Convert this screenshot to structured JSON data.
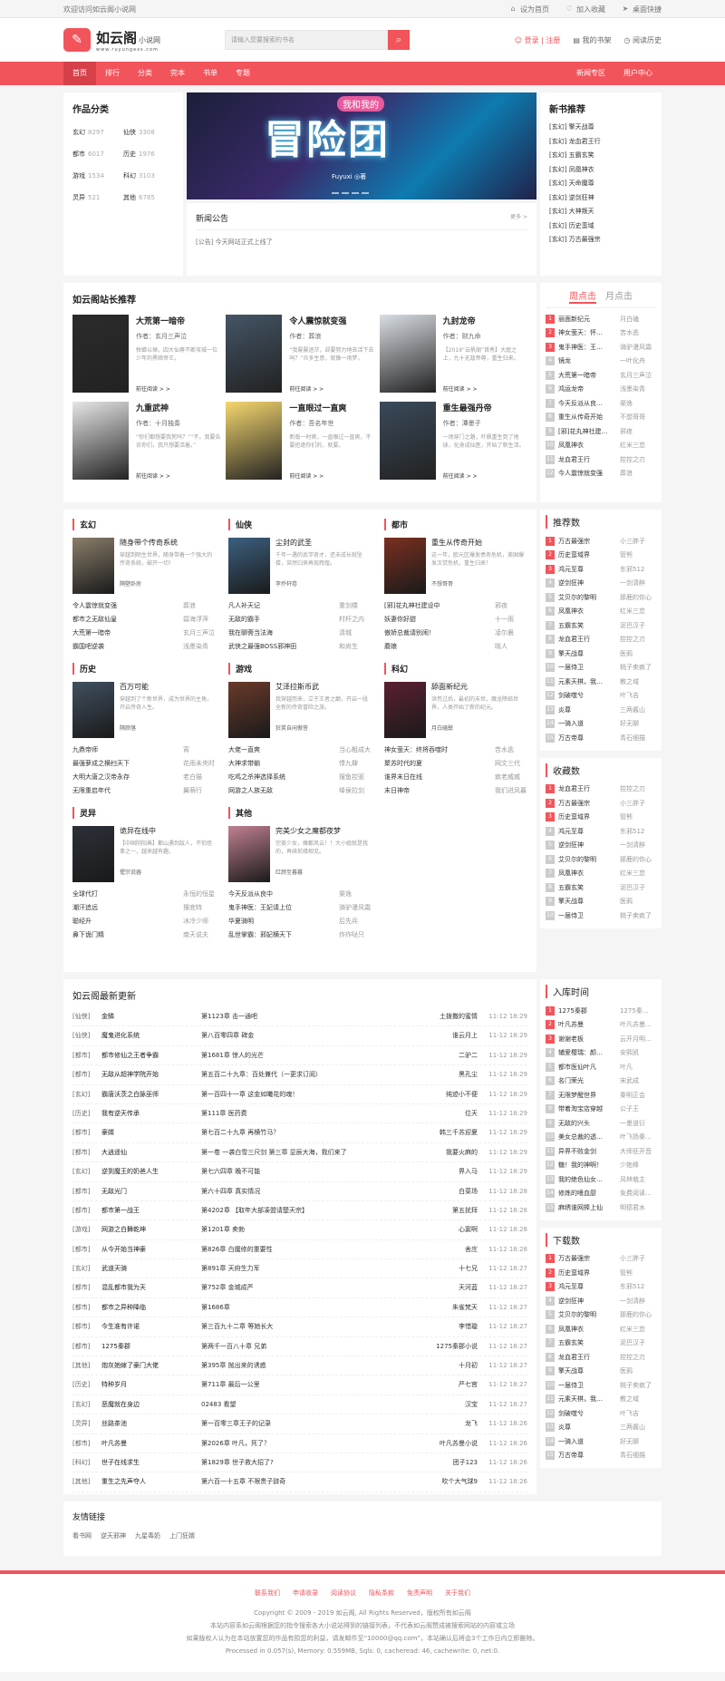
{
  "topbar": {
    "welcome": "欢迎访问如云阁小说网",
    "set_home": "设为首页",
    "favorite": "加入收藏",
    "shortcut": "桌面快捷"
  },
  "header": {
    "logo_name": "如云阁",
    "logo_sub": "小说网",
    "logo_url": "www.ruyungexs.com",
    "search_placeholder": "请输入您要搜索的书名",
    "login": "登录 | 注册",
    "my_shelf": "我的书架",
    "history": "阅读历史"
  },
  "nav": {
    "items": [
      "首页",
      "排行",
      "分类",
      "完本",
      "书单",
      "专题"
    ],
    "right": [
      "新闻专区",
      "用户中心"
    ]
  },
  "categories": {
    "title": "作品分类",
    "items": [
      {
        "name": "玄幻",
        "count": "8297"
      },
      {
        "name": "仙侠",
        "count": "3308"
      },
      {
        "name": "都市",
        "count": "6017"
      },
      {
        "name": "历史",
        "count": "1976"
      },
      {
        "name": "游戏",
        "count": "1534"
      },
      {
        "name": "科幻",
        "count": "3103"
      },
      {
        "name": "灵异",
        "count": "521"
      },
      {
        "name": "其他",
        "count": "6785"
      }
    ]
  },
  "banner": {
    "title": "冒险团",
    "subtitle": "我和我的",
    "author": "Fuyuxi ◎著"
  },
  "news": {
    "title": "新闻公告",
    "more": "更多 >",
    "item": "[公告] 今天网站正式上线了"
  },
  "new_books": {
    "title": "新书推荐",
    "items": [
      "[玄幻] 擎天战尊",
      "[玄幻] 龙血君王行",
      "[玄幻] 五霸玄笑",
      "[玄幻] 凤凰神衣",
      "[玄幻] 天命魔尊",
      "[玄幻] 逆剑狂神",
      "[玄幻] 大神叛天",
      "[玄幻] 历史蛮域",
      "[玄幻] 万古最强宗"
    ]
  },
  "recommend": {
    "title": "如云阁站长推荐",
    "read": "前往阅读 > >",
    "books": [
      {
        "title": "大荒第一暗帝",
        "author": "作者：玄月三声泣",
        "desc": "牧蝉以禅，四大仙尊不断攻城一位少年的黑暗帝王。",
        "color": "#2b2b2b"
      },
      {
        "title": "令人震惊就变强",
        "author": "作者：葬浪",
        "desc": "“我屡屡迷茫，却要努力地去活下去吗？”众多生意，就像一场梦。",
        "color": "#445566"
      },
      {
        "title": "九封龙帝",
        "author": "作者：财九命",
        "desc": "【2019“云帆阁”首秀】大庭之上，九十无敌帝尊，重生归来。",
        "color": "#d9dee4"
      },
      {
        "title": "九重武神",
        "author": "作者：十月独奏",
        "desc": "“你们都想要我死吗？”“不，我要告诉你们，我只想要活着。”",
        "color": "#e6e6e6"
      },
      {
        "title": "一直眼过一直爽",
        "author": "作者：吾名年世",
        "desc": "新版一时爽，一直眼过一直爽，不要拒绝你们的，就要。",
        "color": "#f5d76e"
      },
      {
        "title": "重生最强丹帝",
        "author": "作者：潭墨子",
        "desc": "一场穿门之路，叶枫重生到了地球，化身成仙医，开始了新生活。",
        "color": "#3a4a5a"
      }
    ]
  },
  "rank_click": {
    "tabs": [
      "周点击",
      "月点击"
    ],
    "items": [
      {
        "n": "1",
        "name": "丽面新纪元",
        "au": "月白磕"
      },
      {
        "n": "2",
        "name": "神女萤天：怀…",
        "au": "苦水逃"
      },
      {
        "n": "3",
        "name": "鬼手神医：王…",
        "au": "骑驴漫风霜"
      },
      {
        "n": "4",
        "name": "镜龙",
        "au": "一叶化舟"
      },
      {
        "n": "5",
        "name": "大荒第一暗帝",
        "au": "玄月三声泣"
      },
      {
        "n": "6",
        "name": "鸿运龙帝",
        "au": "浅墨染青"
      },
      {
        "n": "7",
        "name": "今天反派从良…",
        "au": "渠逸"
      },
      {
        "n": "8",
        "name": "重生从传奇开始",
        "au": "不想哥哥"
      },
      {
        "n": "9",
        "name": "[邪]花丸神社建…",
        "au": "邪夜"
      },
      {
        "n": "10",
        "name": "凤凰神衣",
        "au": "红米三恋"
      },
      {
        "n": "11",
        "name": "龙血君王行",
        "au": "控控之刃"
      },
      {
        "n": "12",
        "name": "今人震惊就变强",
        "au": "葬浪"
      }
    ]
  },
  "cat_sections": [
    {
      "name": "玄幻",
      "title": "随身带个传奇系统",
      "desc": "穿越到陌生世界，随身带着一个强大的传奇系统，破开一切！",
      "author": "隔壁卧房",
      "color": "#8a7e6a",
      "list": [
        [
          "令人震惊就变强",
          "葬浪"
        ],
        [
          "都市之无敌仙皇",
          "碧海浮萍"
        ],
        [
          "大荒第一暗帝",
          "玄月三声泣"
        ],
        [
          "霸国吧逆袭",
          "浅墨染青"
        ]
      ]
    },
    {
      "name": "仙侠",
      "title": "尘封的武圣",
      "desc": "千年一遇的武学奇才，还未成长就坠楼，突然归来再现辉煌。",
      "author": "李乔轩卷",
      "color": "#3c6080",
      "list": [
        [
          "凡人补天记",
          "重剑楼"
        ],
        [
          "无敌的霸手",
          "村杆之内"
        ],
        [
          "我在聊斋当法海",
          "清城"
        ],
        [
          "武侠之最强BOSS邪神田",
          "和尚生"
        ]
      ]
    },
    {
      "name": "都市",
      "title": "重生从传奇开始",
      "desc": "这一年，欧元区爆发债务危机，美国爆发次贷危机，重生归来！",
      "author": "不想哥哥",
      "color": "#7a3020",
      "list": [
        [
          "[邪]花丸神社建设中",
          "邪夜"
        ],
        [
          "妖妻你好甜",
          "十一雨"
        ],
        [
          "傲娇总裁请别闹！",
          "凌尔晨"
        ],
        [
          "蘑娘",
          "晓人"
        ]
      ]
    },
    {
      "name": "历史",
      "title": "百万可能",
      "desc": "穿越到了个新世界，成为世界的主角，开启传奇人生。",
      "author": "隔颜落",
      "color": "#405060",
      "list": [
        [
          "九鼎帝师",
          "宵"
        ],
        [
          "最强萝成之横扫天下",
          "花雨未央时"
        ],
        [
          "大明大唐之汉帝永存",
          "老白猫"
        ],
        [
          "无限重启年代",
          "翼萌行"
        ]
      ]
    },
    {
      "name": "游戏",
      "title": "艾泽拉斯币武",
      "desc": "我穿越而来，立于王者之巅，开启一段全新的传奇冒险之旅。",
      "author": "狂笑自闲傲答",
      "color": "#6a3a2a",
      "list": [
        [
          "大佬一直爽",
          "当心粗成大"
        ],
        [
          "大神求带躺",
          "悸九肆"
        ],
        [
          "吃鸡之杀神选择系统",
          "搜鱼控驱"
        ],
        [
          "网游之人族无敌",
          "绛侯拉剑"
        ]
      ]
    },
    {
      "name": "科幻",
      "title": "舔面新纪元",
      "desc": "洪荒过后，最初的末世，魔龙降临世界，人类开始了新的纪元。",
      "author": "月白磕鬃",
      "color": "#5a2030",
      "list": [
        [
          "神女萤天：终将吞噬时",
          "苦水逃"
        ],
        [
          "聚苏时代的夏",
          "网文三代"
        ],
        [
          "谁界末日在线",
          "疯老威威"
        ],
        [
          "末日神帝",
          "我们进风暮"
        ]
      ]
    },
    {
      "name": "灵异",
      "title": "诡异在线中",
      "desc": "【中国阴阳典】都山遇到敌人，不怕怪事之一，越来越有趣。",
      "author": "惺宗说器",
      "color": "#2c3038",
      "list": [
        [
          "全球代打",
          "永恒的恒星"
        ],
        [
          "潮汗追远",
          "搜底特"
        ],
        [
          "聪经升",
          "冰冷少师"
        ],
        [
          "鼻下诡门精",
          "南天说夫"
        ]
      ]
    },
    {
      "name": "其他",
      "title": "完美少女之魔都夜梦",
      "desc": "完美少女，魔都风云！！大小姐就是我的，再续前缘相见。",
      "author": "红颜至暮暮",
      "color": "#c08090",
      "list": [
        [
          "今天反派从良中",
          "渠逸"
        ],
        [
          "鬼手神医：王妃请上位",
          "骑驴漫风霜"
        ],
        [
          "华夏骑明",
          "后先兵"
        ],
        [
          "乱世掌霸：邪妃横天下",
          "炸炸哒只"
        ]
      ]
    }
  ],
  "rank_recommend": {
    "title": "推荐数",
    "items": [
      [
        "1",
        "万古最强宗",
        "小三胖子"
      ],
      [
        "2",
        "历史蛮域界",
        "管熊"
      ],
      [
        "3",
        "鸿元至尊",
        "东邪512"
      ],
      [
        "4",
        "逆剑狂神",
        "一剑清醉"
      ],
      [
        "5",
        "艾贝尔的黎明",
        "那鹿的你心"
      ],
      [
        "6",
        "凤凰神衣",
        "红米三恋"
      ],
      [
        "7",
        "五霸玄笑",
        "泥巴汉子"
      ],
      [
        "8",
        "龙血君王行",
        "控控之刃"
      ],
      [
        "9",
        "擎天战尊",
        "医鸦"
      ],
      [
        "10",
        "一届侍卫",
        "桃子卖疯了"
      ],
      [
        "11",
        "元素天棋，我…",
        "教之域"
      ],
      [
        "12",
        "剑破噬兮",
        "叶飞吉"
      ],
      [
        "13",
        "炎尊",
        "三两酱山"
      ],
      [
        "14",
        "一骑入道",
        "好无聊"
      ],
      [
        "15",
        "万古帝尊",
        "青石细描"
      ]
    ]
  },
  "rank_collect": {
    "title": "收藏数",
    "items": [
      [
        "1",
        "龙血君王行",
        "控控之刃"
      ],
      [
        "2",
        "万古最强宗",
        "小三胖子"
      ],
      [
        "3",
        "历史蛮域界",
        "管熊"
      ],
      [
        "4",
        "鸿元至尊",
        "东邪512"
      ],
      [
        "5",
        "逆剑狂神",
        "一剑清醉"
      ],
      [
        "6",
        "艾贝尔的黎明",
        "那鹿的你心"
      ],
      [
        "7",
        "凤凰神衣",
        "红米三恋"
      ],
      [
        "8",
        "五霸玄笑",
        "泥巴汉子"
      ],
      [
        "9",
        "擎天战尊",
        "医鸦"
      ],
      [
        "10",
        "一届侍卫",
        "桃子卖疯了"
      ]
    ]
  },
  "rank_time": {
    "title": "入库时间",
    "items": [
      [
        "1",
        "1275秦郡",
        "1275秦…"
      ],
      [
        "2",
        "叶凡苏曼",
        "叶凡苏曼…"
      ],
      [
        "3",
        "谢谢老板",
        "云开月明…"
      ],
      [
        "4",
        "辅爱樱瑞：颜…",
        "安熙凯"
      ],
      [
        "5",
        "都市医仙叶凡",
        "叶凡"
      ],
      [
        "6",
        "名门荣光",
        "宋武成"
      ],
      [
        "7",
        "无限梦醒世界",
        "秦明正会"
      ],
      [
        "8",
        "带着淘宝店穿越",
        "公子王"
      ],
      [
        "9",
        "无敌的兴头",
        "一墨道衍"
      ],
      [
        "10",
        "美女总裁的透…",
        "叶飞扬秦…"
      ],
      [
        "11",
        "异界不败金剑",
        "大师狂开音"
      ],
      [
        "12",
        "糖！我的神啊！",
        "少她棒"
      ],
      [
        "13",
        "我的绝色仙女…",
        "风林栽主"
      ],
      [
        "14",
        "修炼的嗜血厨",
        "免费阅读…"
      ],
      [
        "15",
        "麻绣谁网捧上仙",
        "明德君水"
      ]
    ]
  },
  "rank_down": {
    "title": "下载数",
    "items": [
      [
        "1",
        "万古最强宗",
        "小三胖子"
      ],
      [
        "2",
        "历史蛮域界",
        "管熊"
      ],
      [
        "3",
        "鸿元至尊",
        "东邪512"
      ],
      [
        "4",
        "逆剑狂神",
        "一剑清醉"
      ],
      [
        "5",
        "艾贝尔的黎明",
        "那鹿的你心"
      ],
      [
        "6",
        "凤凰神衣",
        "红米三恋"
      ],
      [
        "7",
        "五霸玄笑",
        "泥巴汉子"
      ],
      [
        "8",
        "龙血君王行",
        "控控之刃"
      ],
      [
        "9",
        "擎天战尊",
        "医鸦"
      ],
      [
        "10",
        "一届侍卫",
        "桃子卖疯了"
      ],
      [
        "11",
        "元素天棋，我…",
        "教之域"
      ],
      [
        "12",
        "剑破噬兮",
        "叶飞吉"
      ],
      [
        "13",
        "炎尊",
        "三两酱山"
      ],
      [
        "14",
        "一骑入道",
        "好无聊"
      ],
      [
        "15",
        "万古帝尊",
        "青石细描"
      ]
    ]
  },
  "updates": {
    "title": "如云阁最新更新",
    "rows": [
      [
        "[仙侠]",
        "金鳞",
        "第1123章 击一通吧",
        "土拨撒的蜜情",
        "11-12 18:29"
      ],
      [
        "[仙侠]",
        "魔鬼进化系统",
        "第八百零四章 碑金",
        "谁云月上",
        "11-12 18:29"
      ],
      [
        "[都市]",
        "都市修仙之王者争霸",
        "第1681章 惊人的光芒",
        "二驴二",
        "11-12 18:29"
      ],
      [
        "[都市]",
        "无敌从超神学院开始",
        "第五百二十九章：百处兼代（一更求订阅）",
        "黑孔尘",
        "11-12 18:29"
      ],
      [
        "[玄幻]",
        "霸唐沃茨之白脉巫师",
        "第一百四十一章 这金如曦花的魂！",
        "纯迹小不便",
        "11-12 18:29"
      ],
      [
        "[历史]",
        "我有逆天传承",
        "第111章 医药费",
        "位天",
        "11-12 18:29"
      ],
      [
        "[都市]",
        "豪婿",
        "第七百二十九章 再横竹马？",
        "韩三千苏迎夏",
        "11-12 18:29"
      ],
      [
        "[都市]",
        "大逍遥仙",
        "第一卷 一袭白雪三尺剑 第三章 显辰大海，我们来了",
        "我要火麻的",
        "11-12 18:29"
      ],
      [
        "[玄幻]",
        "逆到魔王的奶爸人生",
        "第七六四章 晚不可能",
        "界入马",
        "11-12 18:29"
      ],
      [
        "[都市]",
        "无敌光门",
        "第六十四章 真实情况",
        "白菜场",
        "11-12 18:28"
      ],
      [
        "[都市]",
        "都市第一战王",
        "第4202章 【取年大部凑盟请楚天宗】",
        "第五扰拜",
        "11-12 18:28"
      ],
      [
        "[游戏]",
        "网游之白舞乾坤",
        "第1201章 卖勃",
        "心窦啊",
        "11-12 18:28"
      ],
      [
        "[都市]",
        "从今开始当神豪",
        "第826章 白魔修的重要性",
        "舍庄",
        "11-12 18:28"
      ],
      [
        "[玄幻]",
        "武道天骑",
        "第891章 天府生力军",
        "十七兄",
        "11-12 18:27"
      ],
      [
        "[都市]",
        "混乱都市我为天",
        "第752章 金城成严",
        "天河蓝",
        "11-12 18:27"
      ],
      [
        "[都市]",
        "都市之异种降临",
        "第1686章",
        "朱雀梵天",
        "11-12 18:27"
      ],
      [
        "[都市]",
        "今生准有许诺",
        "第三百九十二章 等她长大",
        "李惜璇",
        "11-12 18:27"
      ],
      [
        "[都市]",
        "1275秦郡",
        "第两千一百八十章 兄弟",
        "1275秦郡小说",
        "11-12 18:27"
      ],
      [
        "[其他]",
        "炮灰她嫁了豪门大佬",
        "第395章 抛出来的诱惑",
        "十月初",
        "11-12 18:27"
      ],
      [
        "[历史]",
        "特种岁月",
        "第711章 最后一公里",
        "严七官",
        "11-12 18:27"
      ],
      [
        "[玄幻]",
        "恶魔就在身边",
        "02483 看望",
        "汉宝",
        "11-12 18:27"
      ],
      [
        "[灵异]",
        "丝路茶池",
        "第一百零三章王子的记录",
        "龙飞",
        "11-12 18:26"
      ],
      [
        "[都市]",
        "叶凡苏曼",
        "第2026章 叶凡，死了？",
        "叶凡苏曼小说",
        "11-12 18:26"
      ],
      [
        "[科幻]",
        "世子在线求生",
        "第1829章 世子救大招了?",
        "团子123",
        "11-12 18:26"
      ],
      [
        "[其他]",
        "重生之先声夺人",
        "第六百一十五章 不限贵子辞奇",
        "吹个大气球9",
        "11-12 18:26"
      ]
    ]
  },
  "links": {
    "title": "友情链接",
    "items": [
      "看书网",
      "逆天邪神",
      "九星毒奶",
      "上门狂婿"
    ]
  },
  "footer": {
    "links": [
      "联系我们",
      "申请收录",
      "阅读协议",
      "隐私条款",
      "免责声明",
      "关于我们"
    ],
    "copyright": "Copyright © 2009 - 2019 如云阁, All Rights Reserved，版权所有如云阁",
    "line2": "本站内容系如云阁根据您的指令搜索各大小说站得到的链接列表，不代表如云阁赞成被搜索网站的内容或立场",
    "line3": "如果版权人认为在本站放置您的作品有损您的利益，请发邮件至“10000@qq.com”，本站确认后将会3个工作日内立即删除。",
    "line4": "Processed in 0.057(s), Memory: 0.559MB, Sqls: 0, cacheread: 46, cachewrite: 0, net:0."
  },
  "colors": {
    "accent": "#f2545b"
  }
}
